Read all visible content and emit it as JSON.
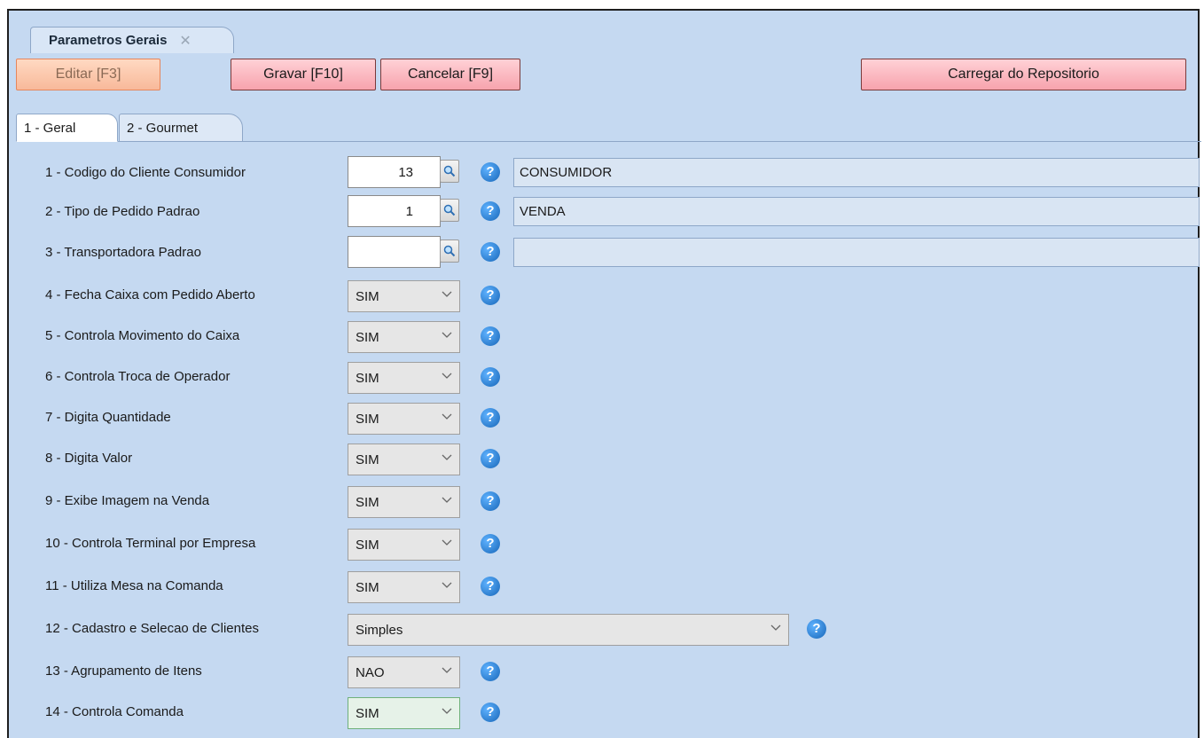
{
  "window": {
    "tab_title": "Parametros Gerais",
    "tab_close": "✕"
  },
  "toolbar": {
    "edit_label": "Editar [F3]",
    "save_label": "Gravar [F10]",
    "cancel_label": "Cancelar [F9]",
    "load_repo_label": "Carregar do Repositorio"
  },
  "tabs": [
    {
      "label": "1 - Geral",
      "active": true
    },
    {
      "label": "2 - Gourmet",
      "active": false
    }
  ],
  "help_glyph": "?",
  "lookup_rows": [
    {
      "label": "1 - Codigo do Cliente Consumidor",
      "value": "13",
      "description": "CONSUMIDOR"
    },
    {
      "label": "2 - Tipo de Pedido Padrao",
      "value": "1",
      "description": "VENDA"
    },
    {
      "label": "3 - Transportadora Padrao",
      "value": "",
      "description": ""
    }
  ],
  "select_rows": [
    {
      "label": "4 - Fecha Caixa com Pedido Aberto",
      "value": "SIM"
    },
    {
      "label": "5 - Controla Movimento do Caixa",
      "value": "SIM"
    },
    {
      "label": "6 - Controla Troca de Operador",
      "value": "SIM"
    },
    {
      "label": "7 - Digita Quantidade",
      "value": "SIM"
    },
    {
      "label": "8 - Digita Valor",
      "value": "SIM"
    },
    {
      "label": "9 - Exibe Imagem na Venda",
      "value": "SIM"
    },
    {
      "label": "10 - Controla Terminal por Empresa",
      "value": "SIM"
    },
    {
      "label": "11 - Utiliza Mesa na Comanda",
      "value": "SIM"
    },
    {
      "label": "12 - Cadastro e Selecao de Clientes",
      "value": "Simples"
    },
    {
      "label": "13 - Agrupamento de Itens",
      "value": "NAO"
    },
    {
      "label": "14 - Controla Comanda",
      "value": "SIM"
    }
  ],
  "icons": {
    "help": "help-question-icon",
    "lookup": "magnifier-icon",
    "dropdown": "chevron-down-icon"
  },
  "colors": {
    "panel_bg": "#c5d9f1",
    "button_pink": "#f7a3ad",
    "disabled_orange": "#f8b99a",
    "help_blue": "#1766b8"
  }
}
